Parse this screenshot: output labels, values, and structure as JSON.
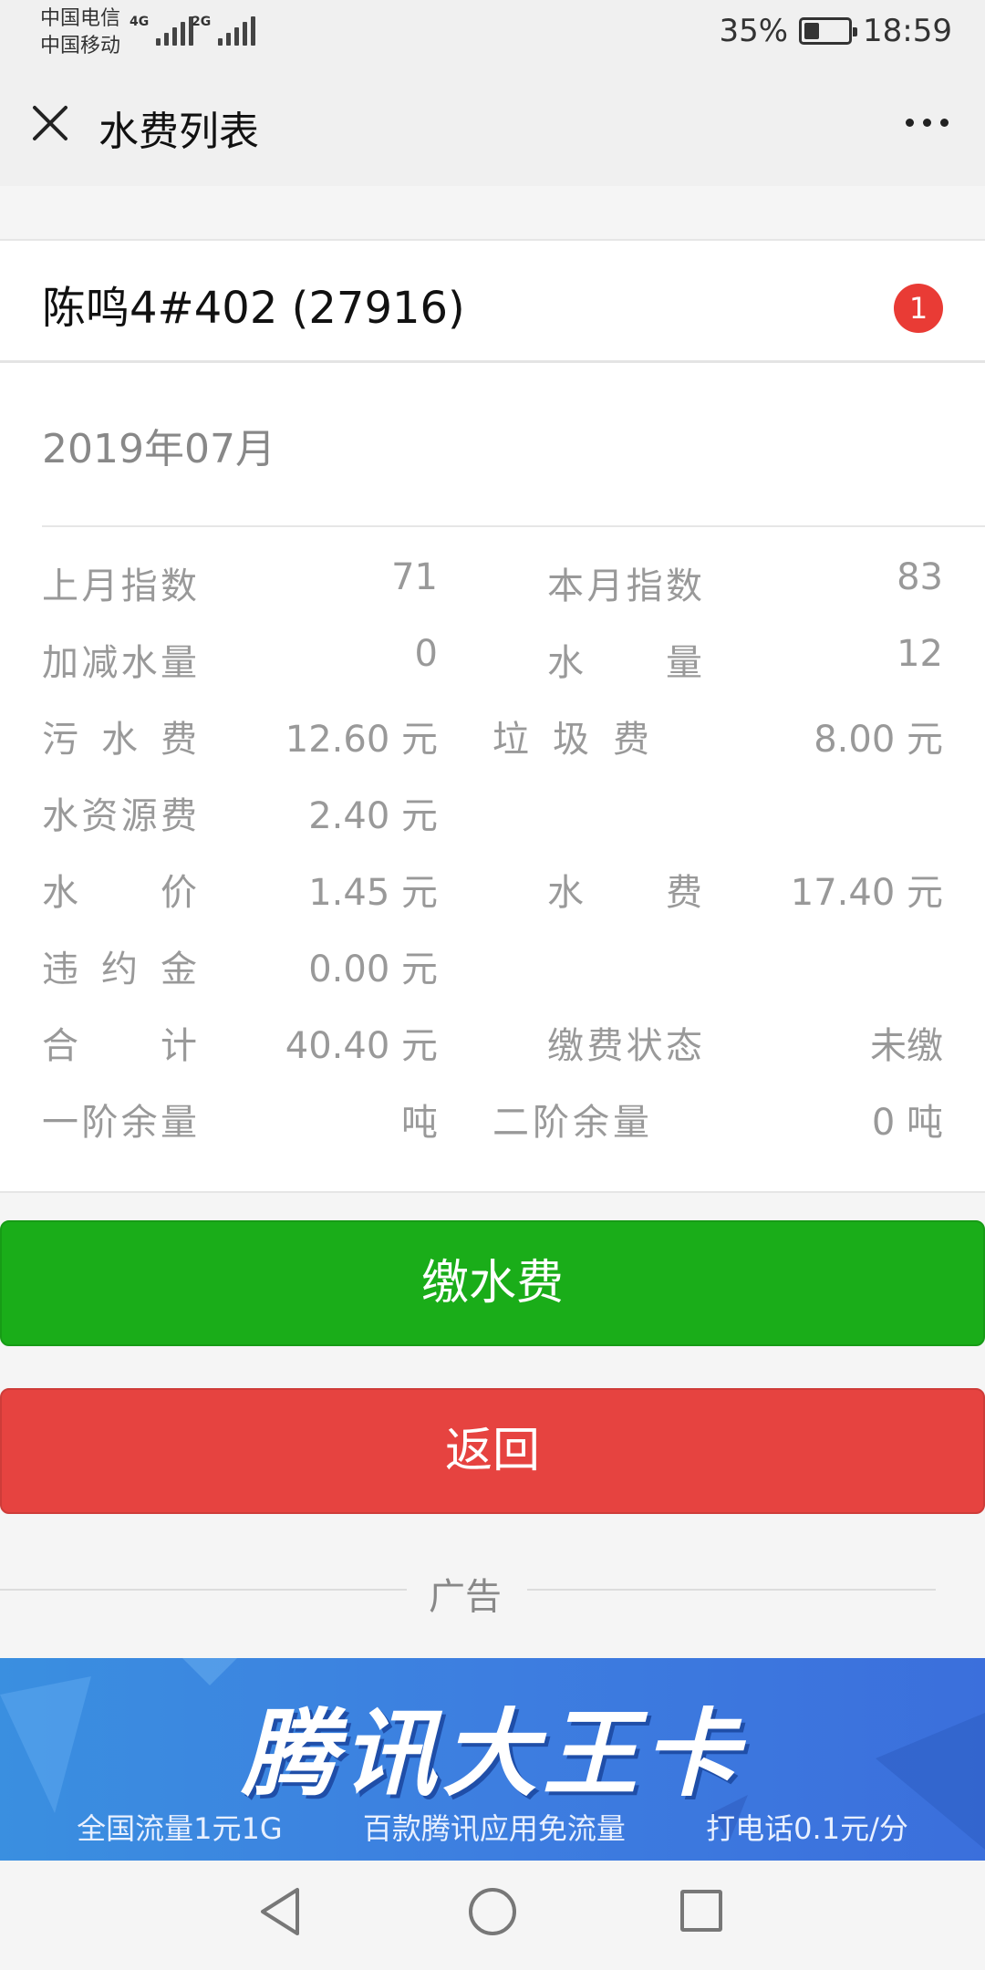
{
  "status_bar": {
    "carrier_1": "中国电信",
    "carrier_2": "中国移动",
    "network_1": "4G",
    "network_2": "2G",
    "battery_percent": "35%",
    "battery_level": 0.35,
    "time": "18:59"
  },
  "header": {
    "title": "水费列表"
  },
  "account": {
    "name": "陈鸣4#402 (27916)",
    "badge_count": "1"
  },
  "bill": {
    "month": "2019年07月",
    "rows": [
      {
        "l1": "上月指数",
        "v1": "71",
        "l2": "本月指数",
        "v2": "83"
      },
      {
        "l1": "加减水量",
        "v1": "0",
        "l2": "水量",
        "v2": "12"
      },
      {
        "l1": "污水费",
        "v1": "12.60 元",
        "l2": "垃圾费",
        "v2": "8.00 元"
      },
      {
        "l1": "水资源费",
        "v1": "2.40 元",
        "l2": "",
        "v2": ""
      },
      {
        "l1": "水价",
        "v1": "1.45 元",
        "l2": "水费",
        "v2": "17.40 元"
      },
      {
        "l1": "违约金",
        "v1": "0.00 元",
        "l2": "",
        "v2": ""
      },
      {
        "l1": "合计",
        "v1": "40.40 元",
        "l2": "缴费状态",
        "v2": "未缴"
      },
      {
        "l1": "一阶余量",
        "v1": "吨",
        "l2": "二阶余量",
        "v2": "0 吨"
      }
    ]
  },
  "actions": {
    "pay_label": "缴水费",
    "back_label": "返回"
  },
  "ad": {
    "label": "广告",
    "title": "腾讯大王卡",
    "taglines": [
      "全国流量1元1G",
      "百款腾讯应用免流量",
      "打电话0.1元/分"
    ]
  },
  "colors": {
    "pay_button": "#1aad19",
    "back_button": "#e64340",
    "badge": "#e93b35",
    "ad_background": "#3d7ee0"
  }
}
